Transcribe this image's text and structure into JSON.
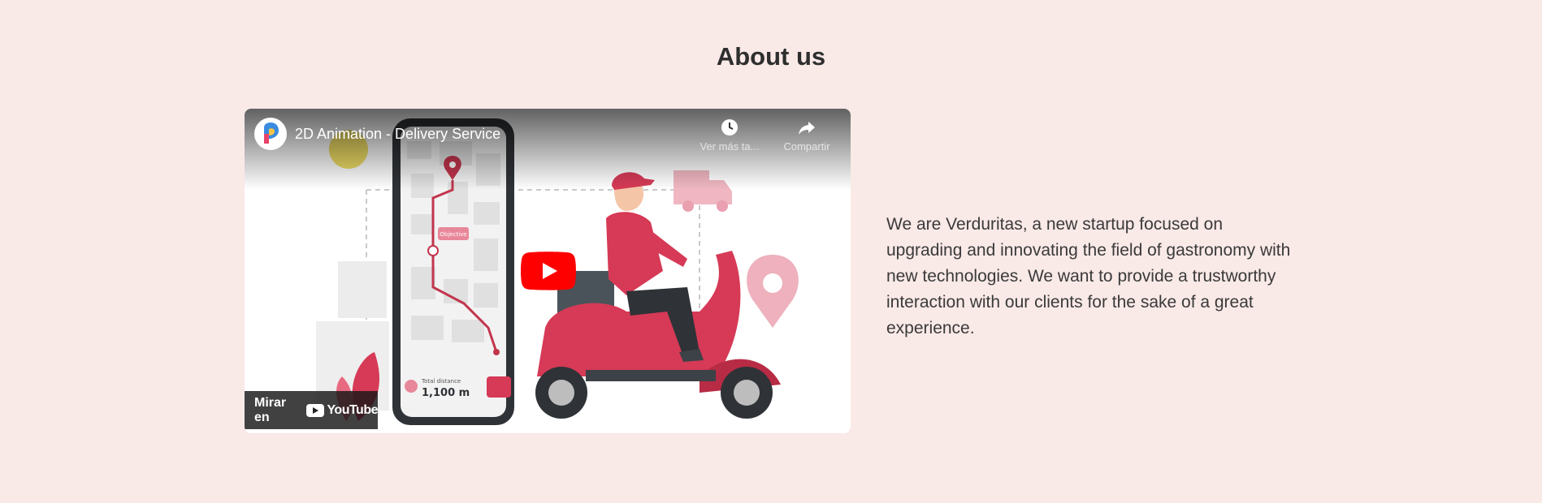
{
  "section": {
    "title": "About us",
    "description": "We are Verduritas, a new startup focused on upgrading and innovating the field of gastronomy with new technologies. We want to provide a trustworthy interaction with our clients for the sake of a great experience."
  },
  "video": {
    "title": "2D Animation - Delivery Service",
    "actions": [
      {
        "label": "Ver más ta...",
        "icon": "clock-icon"
      },
      {
        "label": "Compartir",
        "icon": "share-icon"
      }
    ],
    "watch_on_label": "Mirar en",
    "youtube_label": "YouTube",
    "illustration": {
      "total_distance_label": "Total distance",
      "total_distance_value": "1,100 m",
      "pin_label": "Objective"
    }
  },
  "colors": {
    "background": "#f9e9e7",
    "accent": "#d63a56",
    "youtube_red": "#ff0000"
  }
}
